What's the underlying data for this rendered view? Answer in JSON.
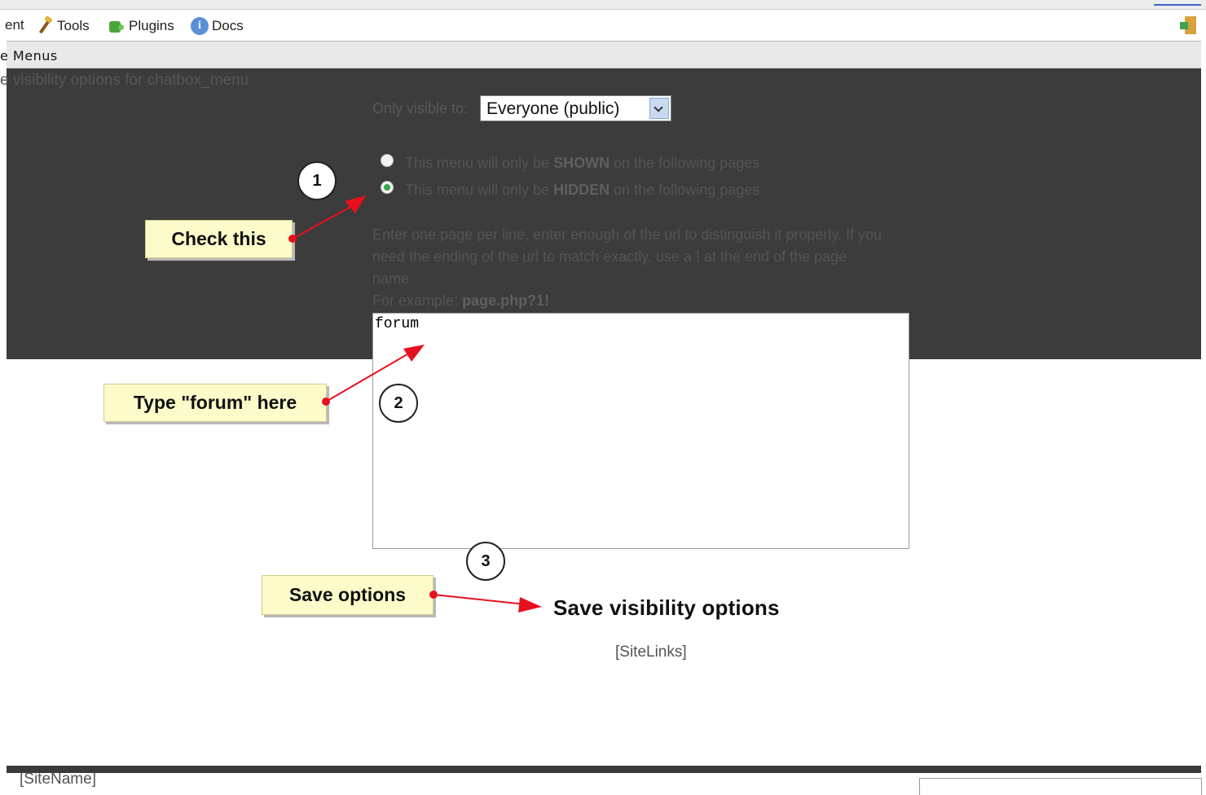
{
  "toolbar": {
    "items": [
      {
        "label": "ent"
      },
      {
        "label": "Tools",
        "icon": "tools-icon"
      },
      {
        "label": "Plugins",
        "icon": "plugins-icon"
      },
      {
        "label": "Docs",
        "icon": "docs-icon"
      }
    ]
  },
  "menus_bar": {
    "label": "e Menus"
  },
  "panel": {
    "title": "e visibility options for chatbox_menu",
    "visibility_label": "Only visible to:",
    "visibility_select": {
      "value": "Everyone (public)"
    },
    "radio_shown": {
      "pre": "This menu will only be",
      "strong": "SHOWN",
      "post": "on the following pages",
      "checked": false
    },
    "radio_hidden": {
      "pre": "This menu will only be",
      "strong": "HIDDEN",
      "post": "on the following pages",
      "checked": true
    },
    "instructions_line1": "Enter one page per line, enter enough of the url to distinguish it properly. If you",
    "instructions_line2": "need the ending of the url to match exactly, use a ! at the end of the page",
    "instructions_line3": "name",
    "example_label": "For example:",
    "example_value": "page.php?1!",
    "pages_textarea": {
      "value": "forum"
    }
  },
  "annotations": {
    "callout_1": "Check this",
    "callout_2": "Type \"forum\" here",
    "callout_3": "Save options",
    "step_1": "1",
    "step_2": "2",
    "step_3": "3"
  },
  "save_button": {
    "label": "Save visibility options"
  },
  "footer": {
    "sitelinks": "[SiteLinks]",
    "sitename": "[SiteName]"
  },
  "colors": {
    "dark_panel": "#3c3c3c",
    "callout_bg": "#fdfbc9",
    "arrow": "#e8101e",
    "radio_checked": "#35a848"
  }
}
